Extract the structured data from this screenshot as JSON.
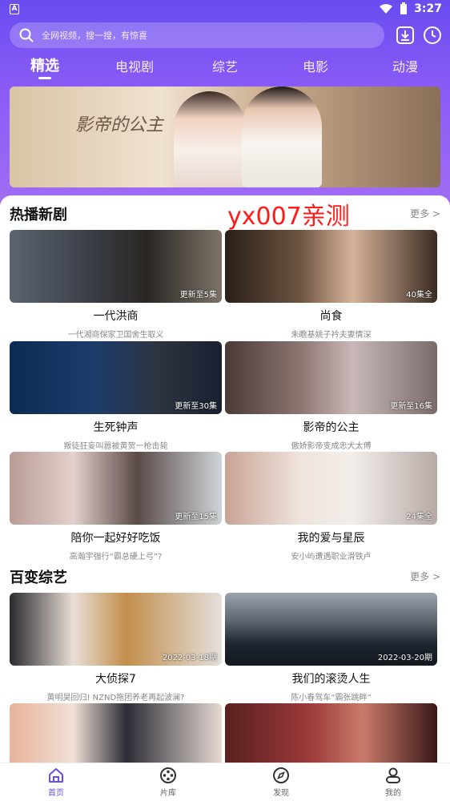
{
  "status_bar": {
    "time": "3:27",
    "app_indicator": "A"
  },
  "search": {
    "placeholder": "全网视频，搜一搜，有惊喜"
  },
  "tabs": [
    {
      "label": "精选",
      "active": true
    },
    {
      "label": "电视剧",
      "active": false
    },
    {
      "label": "综艺",
      "active": false
    },
    {
      "label": "电影",
      "active": false
    },
    {
      "label": "动漫",
      "active": false
    }
  ],
  "banner": {
    "caption": "影帝的公主"
  },
  "watermark": "yx007亲测",
  "sections": [
    {
      "title": "热播新剧",
      "more": "更多 >",
      "items": [
        {
          "title": "一代洪商",
          "subtitle": "一代湘商保家卫国舍生取义",
          "badge": "更新至5集"
        },
        {
          "title": "尚食",
          "subtitle": "朱瞻基姚子衿夫妻情深",
          "badge": "40集全"
        },
        {
          "title": "生死钟声",
          "subtitle": "叛徒狂妄叫嚣被黄贺一枪击毙",
          "badge": "更新至30集"
        },
        {
          "title": "影帝的公主",
          "subtitle": "傲娇影帝变成忠犬太傅",
          "badge": "更新至16集"
        },
        {
          "title": "陪你一起好好吃饭",
          "subtitle": "高瀚宇强行“霸总硬上弓”?",
          "badge": "更新至15集"
        },
        {
          "title": "我的爱与星辰",
          "subtitle": "安小屿遭遇职业滑铁卢",
          "badge": "24集全"
        }
      ]
    },
    {
      "title": "百变综艺",
      "more": "更多 >",
      "items": [
        {
          "title": "大侦探7",
          "subtitle": "黄明昊回归! NZND拖团养老再起波澜?",
          "badge": "2022-03-18期"
        },
        {
          "title": "我们的滚烫人生",
          "subtitle": "陈小春驾车“霸张跳畔”",
          "badge": "2022-03-20期"
        }
      ]
    }
  ],
  "bottom_nav": [
    {
      "label": "首页",
      "icon": "home-icon",
      "active": true
    },
    {
      "label": "片库",
      "icon": "film-reel-icon",
      "active": false
    },
    {
      "label": "发现",
      "icon": "compass-icon",
      "active": false
    },
    {
      "label": "我的",
      "icon": "user-icon",
      "active": false
    }
  ],
  "colors": {
    "accent": "#6a4cf0",
    "header_gradient_end": "#a26df3",
    "watermark": "#ff1a1a"
  }
}
